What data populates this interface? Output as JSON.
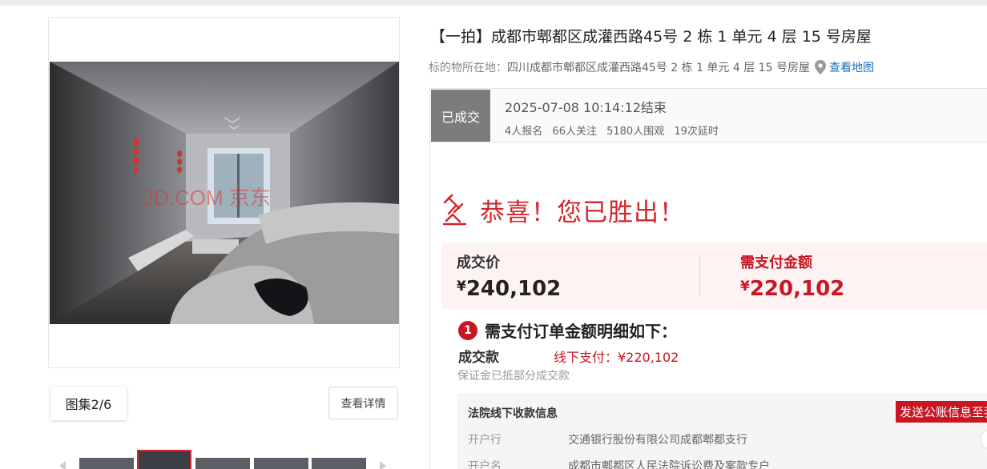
{
  "gallery": {
    "watermark": "JD.COM 京东",
    "count_label": "图集2/6",
    "detail_button": "查看详情",
    "thumb_count": 5,
    "active_thumb": 2
  },
  "item": {
    "title": "【一拍】成都市郫都区成灌西路45号 2 栋 1 单元 4 层 15 号房屋",
    "location_label": "标的物所在地：",
    "location_value": "四川成都市郫都区成灌西路45号 2 栋 1 单元 4 层 15 号房屋",
    "map_link": "查看地图"
  },
  "status": {
    "badge": "已成交",
    "end_time": "2025-07-08 10:14:12结束",
    "stats": [
      "4人报名",
      "66人关注",
      "5180人围观",
      "19次延时"
    ]
  },
  "result": {
    "win_message": "恭喜！您已胜出！",
    "deal_price_label": "成交价",
    "deal_price_currency": "¥",
    "deal_price_value": "240,102",
    "due_label": "需支付金额",
    "due_currency": "¥",
    "due_value": "220,102",
    "step_number": "1",
    "detail_heading": "需支付订单金额明细如下：",
    "pay_label": "成交款",
    "pay_offline": "线下支付：¥220,102",
    "pay_note": "保证金已抵部分成交款"
  },
  "court": {
    "title": "法院线下收款信息",
    "send_button": "发送公账信息至我",
    "rows": [
      {
        "key": "开户行",
        "value": "交通银行股份有限公司成都郫都支行"
      },
      {
        "key": "开户名",
        "value": "成都市郫都区人民法院诉讼费及案款专户"
      }
    ]
  },
  "colors": {
    "accent_red": "#c81623",
    "badge_gray": "#7c7c7c",
    "link_blue": "#1a6fb8"
  }
}
